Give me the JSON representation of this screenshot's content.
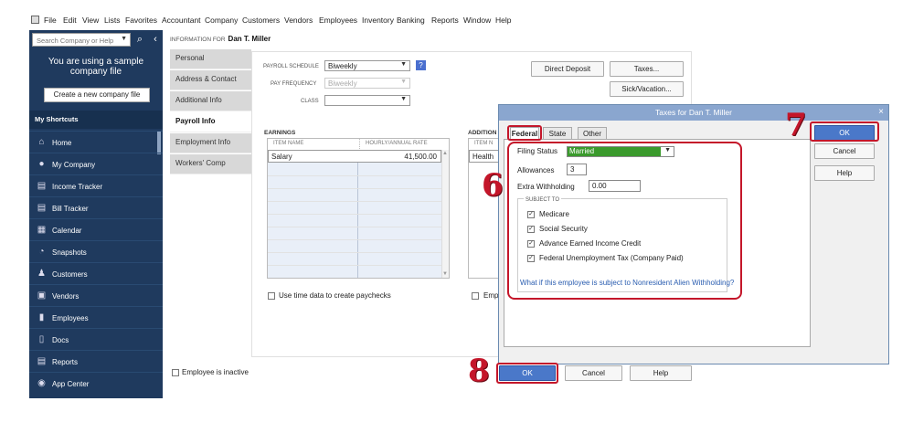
{
  "menu": [
    "File",
    "Edit",
    "View",
    "Lists",
    "Favorites",
    "Accountant",
    "Company",
    "Customers",
    "Vendors",
    "Employees",
    "Inventory",
    "Banking",
    "Reports",
    "Window",
    "Help"
  ],
  "sidebar": {
    "search_placeholder": "Search Company or Help",
    "sample_line1": "You are using a sample",
    "sample_line2": "company file",
    "create_label": "Create a new company file",
    "shortcuts_header": "My Shortcuts",
    "items": [
      {
        "label": "Home",
        "icon": "home-icon"
      },
      {
        "label": "My Company",
        "icon": "company-icon"
      },
      {
        "label": "Income Tracker",
        "icon": "income-icon"
      },
      {
        "label": "Bill Tracker",
        "icon": "bill-icon"
      },
      {
        "label": "Calendar",
        "icon": "calendar-icon"
      },
      {
        "label": "Snapshots",
        "icon": "pie-icon"
      },
      {
        "label": "Customers",
        "icon": "person-icon"
      },
      {
        "label": "Vendors",
        "icon": "vendor-icon"
      },
      {
        "label": "Employees",
        "icon": "employee-icon"
      },
      {
        "label": "Docs",
        "icon": "doc-icon"
      },
      {
        "label": "Reports",
        "icon": "report-icon"
      },
      {
        "label": "App Center",
        "icon": "app-icon"
      }
    ]
  },
  "info": {
    "prefix": "INFORMATION FOR",
    "name": "Dan T. Miller"
  },
  "tabs": [
    "Personal",
    "Address & Contact",
    "Additional Info",
    "Payroll Info",
    "Employment Info",
    "Workers' Comp"
  ],
  "payroll": {
    "schedule_label": "PAYROLL SCHEDULE",
    "schedule_value": "Biweekly",
    "freq_label": "PAY FREQUENCY",
    "freq_value": "Biweekly",
    "class_label": "CLASS",
    "class_value": "",
    "direct_deposit": "Direct Deposit",
    "taxes": "Taxes...",
    "sick": "Sick/Vacation...",
    "earnings_title": "EARNINGS",
    "col_item": "ITEM NAME",
    "col_rate": "HOURLY/ANNUAL RATE",
    "item": "Salary",
    "rate": "41,500.00",
    "addition_title": "ADDITION",
    "addition_col": "ITEM N",
    "addition_item": "Health",
    "timedata_label": "Use time data to create paychecks",
    "emp_label": "Emp",
    "inactive_label": "Employee is inactive"
  },
  "dialog": {
    "title": "Taxes for Dan T. Miller",
    "tabs": [
      "Federal",
      "State",
      "Other"
    ],
    "filing_label": "Filing Status",
    "filing_value": "Married",
    "allow_label": "Allowances",
    "allow_value": "3",
    "extra_label": "Extra Withholding",
    "extra_value": "0.00",
    "subject_label": "SUBJECT TO",
    "checks": [
      "Medicare",
      "Social Security",
      "Advance Earned Income Credit",
      "Federal Unemployment Tax (Company Paid)"
    ],
    "link": "What if this employee is subject to Nonresident Alien Withholding?",
    "ok": "OK",
    "cancel": "Cancel",
    "help": "Help"
  },
  "footer": {
    "ok": "OK",
    "cancel": "Cancel",
    "help": "Help"
  },
  "annotations": {
    "n6": "6",
    "n7": "7",
    "n8": "8"
  },
  "colors": {
    "sidebar": "#1f3a5e",
    "accent": "#4a78c9",
    "highlight": "#c4162a",
    "filing_bg": "#3a9a2c"
  }
}
